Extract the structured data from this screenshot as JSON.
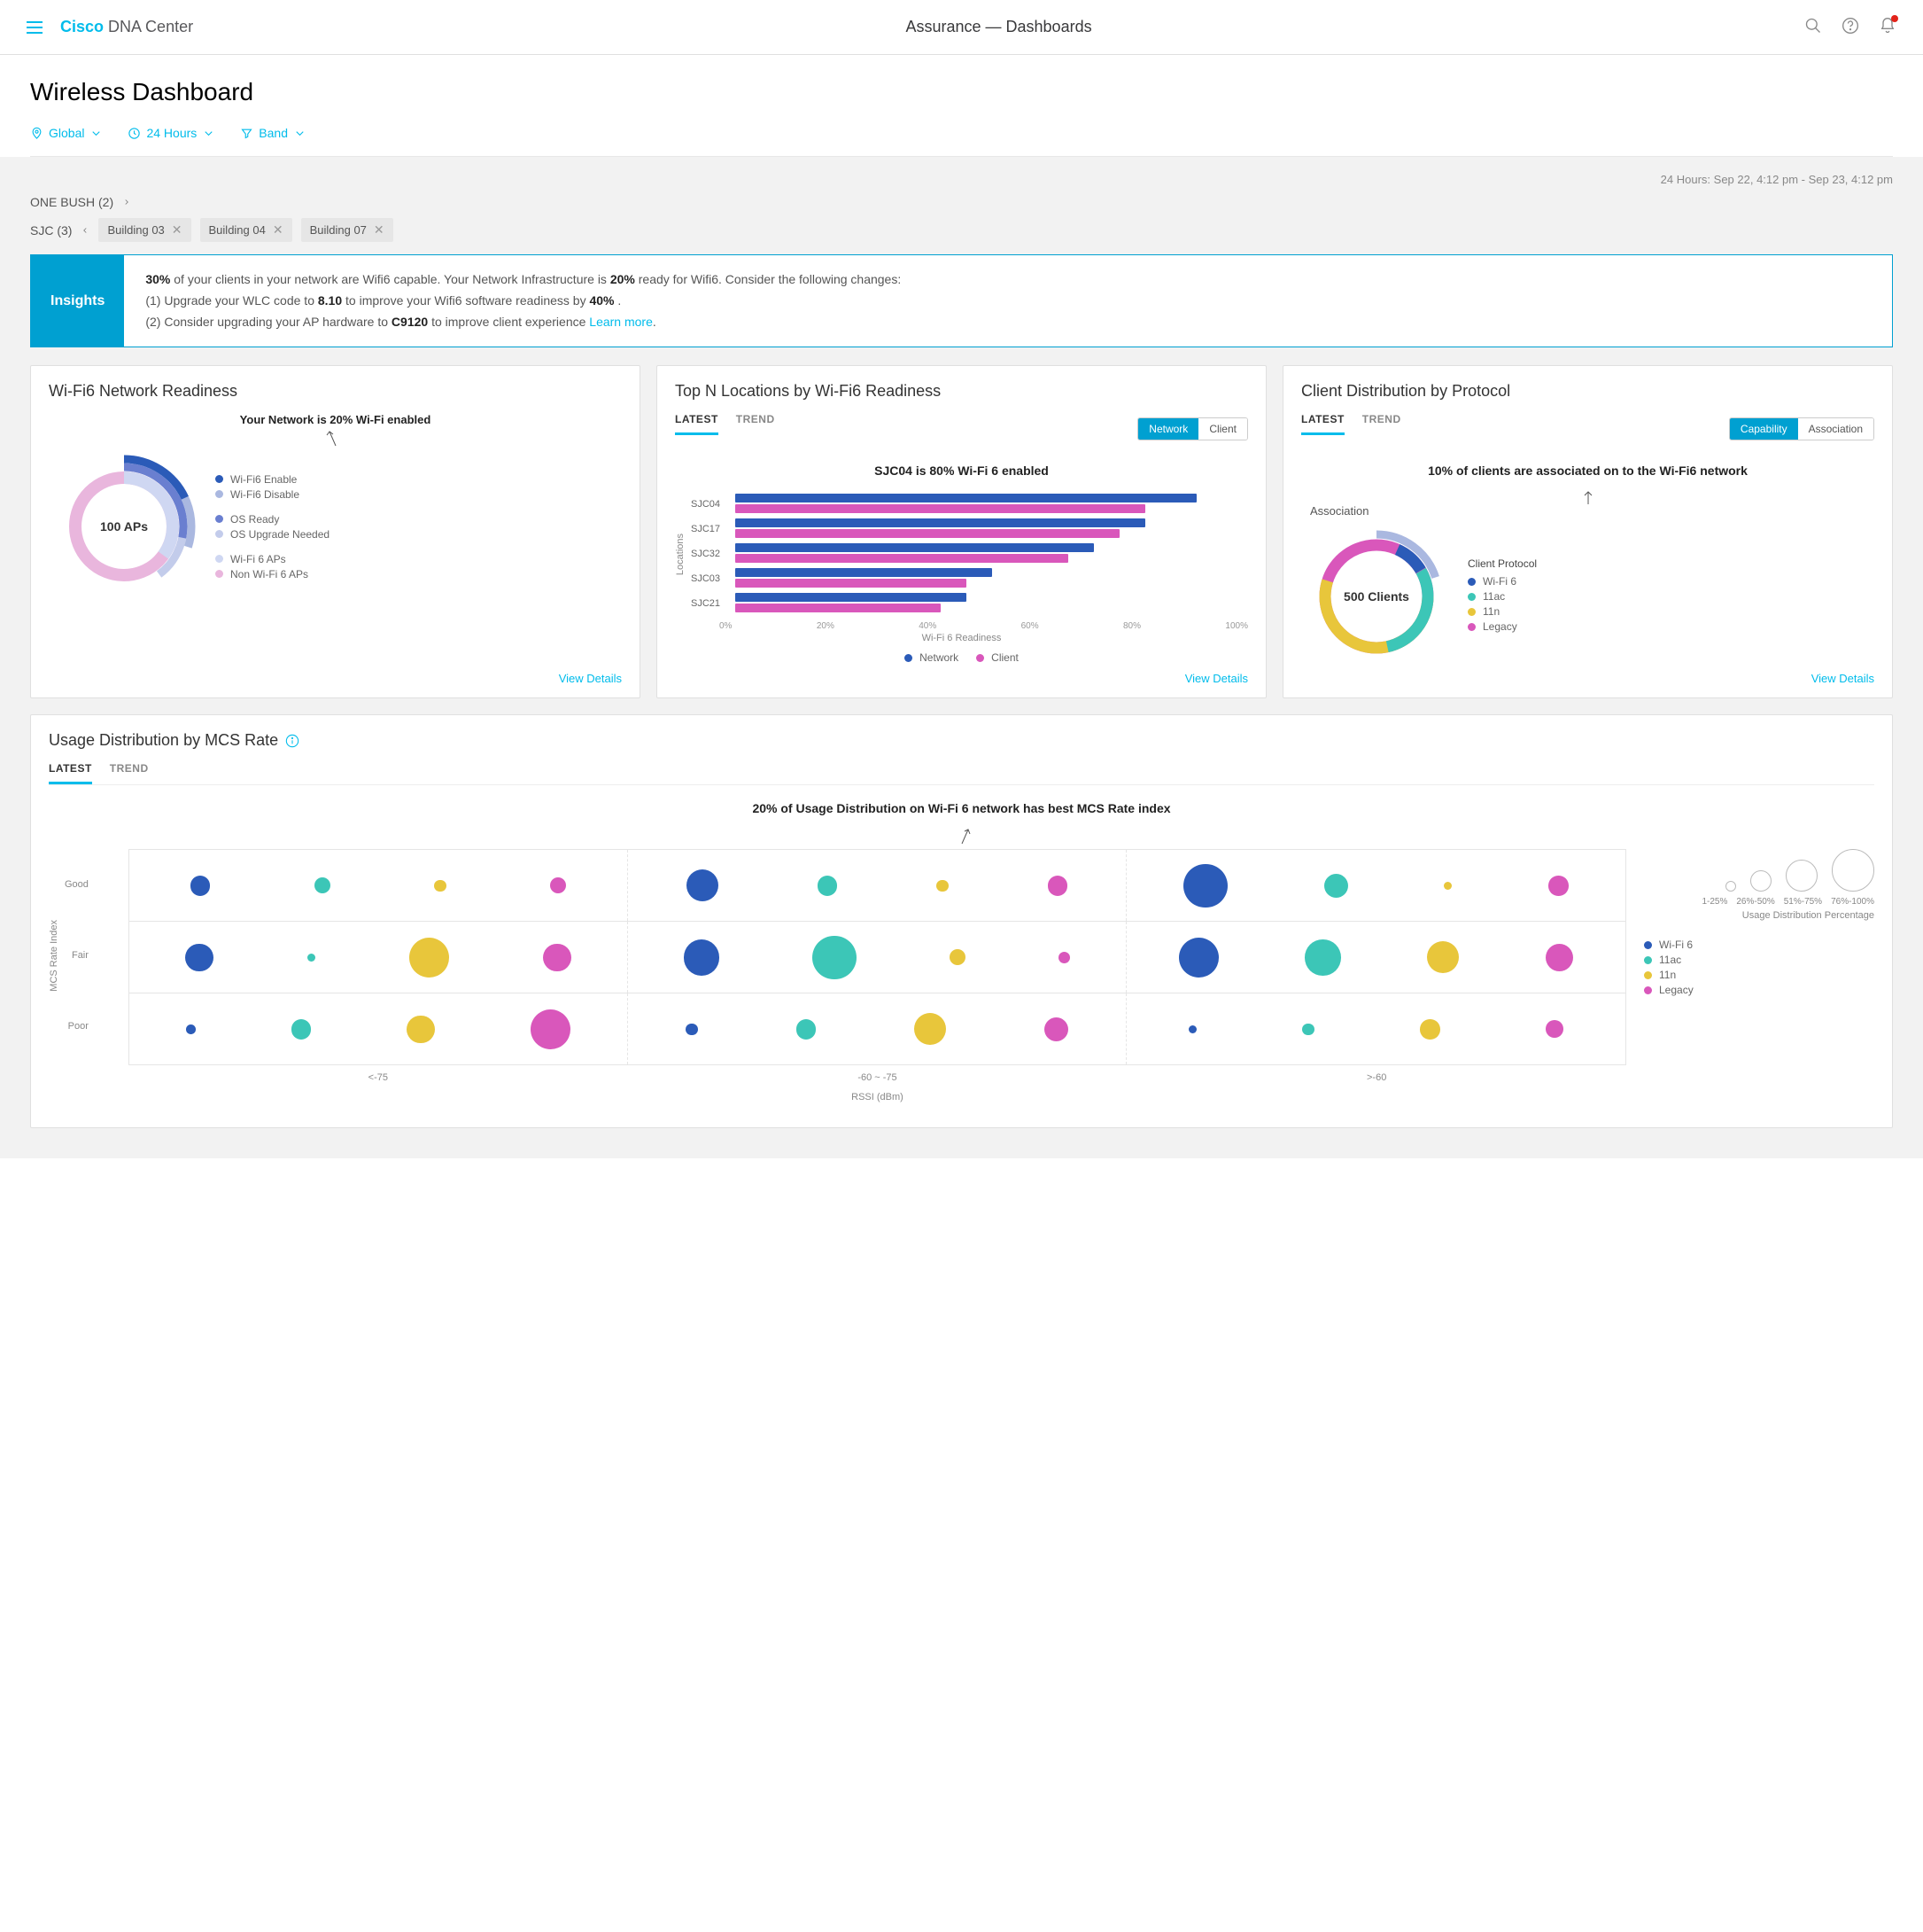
{
  "header": {
    "brand_bold": "Cisco",
    "brand_rest": "DNA Center",
    "breadcrumb": "Assurance — Dashboards"
  },
  "page": {
    "title": "Wireless Dashboard",
    "filters": {
      "location": "Global",
      "time": "24 Hours",
      "band": "Band"
    },
    "time_range": "24 Hours: Sep 22, 4:12 pm - Sep 23, 4:12 pm",
    "loc1": {
      "name": "ONE BUSH (2)"
    },
    "loc2": {
      "name": "SJC (3)",
      "chips": [
        "Building 03",
        "Building 04",
        "Building 07"
      ]
    }
  },
  "insights": {
    "label": "Insights",
    "line1a": "30%",
    "line1b": " of your clients in your network are Wifi6 capable. Your Network Infrastructure is ",
    "line1c": "20%",
    "line1d": " ready for Wifi6. Consider the following changes:",
    "line2a": "(1) Upgrade your WLC code to ",
    "line2b": "8.10",
    "line2c": " to improve your Wifi6 software readiness by ",
    "line2d": "40%",
    "line2e": " .",
    "line3a": "(2) Consider upgrading your AP hardware to ",
    "line3b": "C9120",
    "line3c": " to improve client experience ",
    "link": "Learn more"
  },
  "tabs": {
    "latest": "LATEST",
    "trend": "TREND"
  },
  "view_details": "View Details",
  "card1": {
    "title": "Wi-Fi6 Network Readiness",
    "headline": "Your Network is 20% Wi-Fi enabled",
    "center": "100 APs",
    "legend": [
      "Wi-Fi6 Enable",
      "Wi-Fi6 Disable",
      "OS Ready",
      "OS Upgrade Needed",
      "Wi-Fi 6 APs",
      "Non Wi-Fi 6 APs"
    ]
  },
  "card2": {
    "title": "Top N Locations by Wi-Fi6 Readiness",
    "toggle": {
      "a": "Network",
      "b": "Client"
    },
    "headline": "SJC04 is 80% Wi-Fi 6 enabled",
    "ylabel": "Locations",
    "xlabel": "Wi-Fi 6 Readiness",
    "legend": {
      "net": "Network",
      "cli": "Client"
    }
  },
  "card3": {
    "title": "Client Distribution by Protocol",
    "toggle": {
      "a": "Capability",
      "b": "Association"
    },
    "headline": "10% of clients are associated on to the Wi-Fi6 network",
    "note": "Association",
    "center": "500 Clients",
    "legend_title": "Client Protocol",
    "legend": [
      "Wi-Fi 6",
      "11ac",
      "11n",
      "Legacy"
    ]
  },
  "card4": {
    "title": "Usage Distribution by MCS Rate",
    "headline": "20% of Usage Distribution on Wi-Fi 6 network has best MCS Rate index",
    "rows": [
      "Good",
      "Fair",
      "Poor"
    ],
    "cols": [
      "<-75",
      "-60 ~ -75",
      ">-60"
    ],
    "xlabel": "RSSI (dBm)",
    "ylabel": "MCS Rate Index",
    "size_bins": [
      "1-25%",
      "26%-50%",
      "51%-75%",
      "76%-100%"
    ],
    "size_title": "Usage Distribution Percentage",
    "legend": [
      "Wi-Fi 6",
      "11ac",
      "11n",
      "Legacy"
    ]
  },
  "colors": {
    "wifi6": "#2b5bb8",
    "ac": "#3cc6b7",
    "n": "#e8c63b",
    "legacy": "#d957bb",
    "enable": "#2b5bb8",
    "disable": "#aab8e0",
    "osready": "#6a7fd0",
    "osupgrade": "#c3cceb",
    "aps6": "#cfd7f2",
    "nonaps": "#e9b6dd"
  },
  "chart_data": {
    "readiness_donut": {
      "type": "pie",
      "note": "three concentric rings; values are percentages of 360°",
      "inner_ring": [
        {
          "name": "Wi-Fi 6 APs",
          "value": 35
        },
        {
          "name": "Non Wi-Fi 6 APs",
          "value": 65
        }
      ],
      "mid_ring": [
        {
          "name": "OS Ready",
          "value": 28
        },
        {
          "name": "OS Upgrade Needed",
          "value": 12
        }
      ],
      "outer_ring": [
        {
          "name": "Wi-Fi6 Enable",
          "value": 18
        },
        {
          "name": "Wi-Fi6 Disable",
          "value": 12
        }
      ],
      "center_label": "100 APs"
    },
    "top_locations": {
      "type": "bar",
      "categories": [
        "SJC04",
        "SJC17",
        "SJC32",
        "SJC03",
        "SJC21"
      ],
      "series": [
        {
          "name": "Network",
          "values": [
            90,
            80,
            70,
            50,
            45
          ]
        },
        {
          "name": "Client",
          "values": [
            80,
            75,
            65,
            45,
            40
          ]
        }
      ],
      "xlabel": "Wi-Fi 6 Readiness",
      "ylabel": "Locations",
      "xlim": [
        0,
        100
      ],
      "xticks": [
        0,
        20,
        40,
        60,
        80,
        100
      ]
    },
    "client_distribution": {
      "type": "pie",
      "series": [
        {
          "name": "Wi-Fi 6",
          "value": 10
        },
        {
          "name": "11ac",
          "value": 20
        },
        {
          "name": "11n",
          "value": 25
        },
        {
          "name": "Legacy",
          "value": 45
        }
      ],
      "outer_arc": {
        "name": "Association",
        "value": 20
      },
      "center_label": "500 Clients"
    },
    "mcs_bubbles": {
      "type": "scatter",
      "rows": [
        "Good",
        "Fair",
        "Poor"
      ],
      "cols": [
        "<-75",
        "-60 ~ -75",
        ">-60"
      ],
      "protocols": [
        "Wi-Fi 6",
        "11ac",
        "11n",
        "Legacy"
      ],
      "size_scale_percent": [
        10,
        25,
        50,
        80
      ],
      "data": [
        [
          [
            25,
            20,
            15,
            20
          ],
          [
            40,
            25,
            15,
            25
          ],
          [
            55,
            30,
            10,
            25
          ]
        ],
        [
          [
            35,
            10,
            50,
            35
          ],
          [
            45,
            55,
            20,
            15
          ],
          [
            50,
            45,
            40,
            35
          ]
        ],
        [
          [
            12,
            25,
            35,
            50
          ],
          [
            15,
            25,
            40,
            30
          ],
          [
            10,
            15,
            25,
            22
          ]
        ]
      ]
    }
  }
}
